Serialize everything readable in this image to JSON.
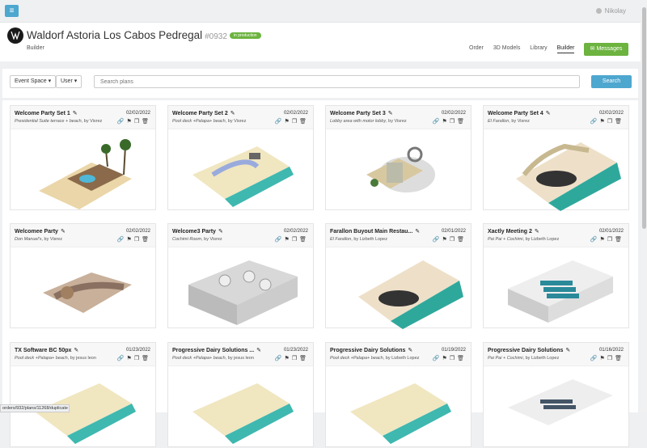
{
  "topbar": {
    "user": "Nikolay"
  },
  "header": {
    "hotel": "Waldorf Astoria Los Cabos Pedregal",
    "hotel_id": "#0932",
    "badge": "in production",
    "subtitle": "Builder",
    "nav": [
      "Order",
      "3D Models",
      "Library",
      "Builder"
    ],
    "messages": "Messages"
  },
  "filters": {
    "event_space": "Event Space",
    "user": "User",
    "search_placeholder": "Search plans",
    "search_button": "Search"
  },
  "cards": [
    {
      "title": "Welcome Party Set 1",
      "date": "02/02/2022",
      "loc": "Presidential Suite terrace + beach",
      "by": "Visrez"
    },
    {
      "title": "Welcome Party Set 2",
      "date": "02/02/2022",
      "loc": "Pool deck +Palapa+ beach",
      "by": "Visrez"
    },
    {
      "title": "Welcome Party Set 3",
      "date": "02/02/2022",
      "loc": "Lobby area with motor lobby",
      "by": "Visrez"
    },
    {
      "title": "Welcome Party Set 4",
      "date": "02/02/2022",
      "loc": "El Farallon",
      "by": "Visrez"
    },
    {
      "title": "Welcomee Party",
      "date": "02/02/2022",
      "loc": "Don Manuel's",
      "by": "Visrez"
    },
    {
      "title": "Welcome3 Party",
      "date": "02/02/2022",
      "loc": "Cochimi Room",
      "by": "Visrez"
    },
    {
      "title": "Farallon Buyout Main Restau...",
      "date": "02/01/2022",
      "loc": "El Farallon",
      "by": "Lizbeth Lopez"
    },
    {
      "title": "Xactly Meeting 2",
      "date": "02/01/2022",
      "loc": "Pai Pai + Cochimi",
      "by": "Lizbeth Lopez"
    },
    {
      "title": "TX Software BC 50px",
      "date": "01/23/2022",
      "loc": "Pool deck +Palapa+ beach",
      "by": "jesus leon"
    },
    {
      "title": "Progressive Dairy Solutions ...",
      "date": "01/23/2022",
      "loc": "Pool deck +Palapa+ beach",
      "by": "jesus leon"
    },
    {
      "title": "Progressive Dairy Solutions",
      "date": "01/19/2022",
      "loc": "Pool deck +Palapa+ beach",
      "by": "Lizbeth Lopez"
    },
    {
      "title": "Progressive Dairy Solutions",
      "date": "01/16/2022",
      "loc": "Pai Pai + Cochimi",
      "by": "Lizbeth Lopez"
    }
  ],
  "status_url": "orders/932/plans/11268/duplicate"
}
